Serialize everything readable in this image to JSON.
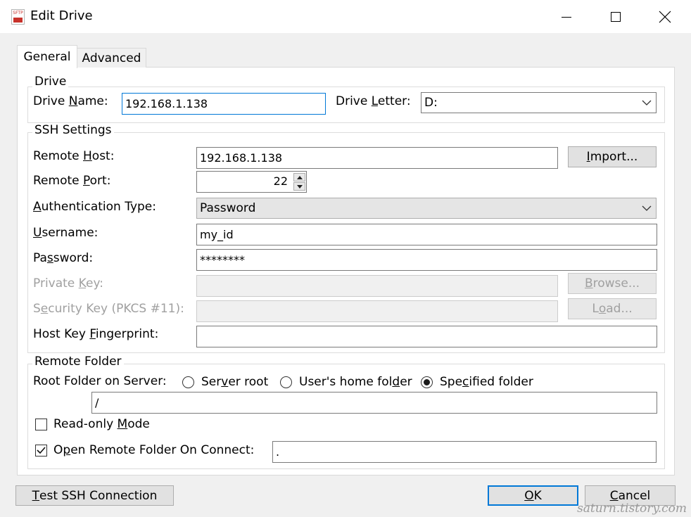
{
  "window": {
    "title": "Edit Drive",
    "app_icon_text": "SFTP"
  },
  "tabs": [
    {
      "label": "General",
      "selected": true
    },
    {
      "label": "Advanced",
      "selected": false
    }
  ],
  "drive": {
    "legend": "Drive",
    "name_label_pre": "Drive ",
    "name_label_u": "N",
    "name_label_post": "ame:",
    "name_value": "192.168.1.138",
    "letter_label_pre": "Drive ",
    "letter_label_u": "L",
    "letter_label_post": "etter:",
    "letter_value": "D:"
  },
  "ssh": {
    "legend": "SSH Settings",
    "host_label_pre": "Remote ",
    "host_label_u": "H",
    "host_label_post": "ost:",
    "host_value": "192.168.1.138",
    "import_pre": "",
    "import_u": "I",
    "import_post": "mport...",
    "port_label_pre": "Remote ",
    "port_label_u": "P",
    "port_label_post": "ort:",
    "port_value": "22",
    "auth_label_pre": "",
    "auth_label_u": "A",
    "auth_label_post": "uthentication Type:",
    "auth_value": "Password",
    "user_label_pre": "",
    "user_label_u": "U",
    "user_label_post": "sername:",
    "user_value": "my_id",
    "pass_label_pre": "Pa",
    "pass_label_u": "s",
    "pass_label_post": "sword:",
    "pass_value": "********",
    "pkey_label_pre": "Private ",
    "pkey_label_u": "K",
    "pkey_label_post": "ey:",
    "pkey_value": "",
    "browse_pre": "",
    "browse_u": "B",
    "browse_post": "rowse...",
    "seckey_label_pre": "S",
    "seckey_label_u": "e",
    "seckey_label_post": "curity Key (PKCS #11):",
    "seckey_value": "",
    "load_pre": "L",
    "load_u": "o",
    "load_post": "ad...",
    "fp_label_pre": "Host Key ",
    "fp_label_u": "F",
    "fp_label_post": "ingerprint:",
    "fp_value": ""
  },
  "remote": {
    "legend": "Remote Folder",
    "root_label": "Root Folder on Server:",
    "opt_server_pre": "Ser",
    "opt_server_u": "v",
    "opt_server_post": "er root",
    "opt_home_pre": "User's home fol",
    "opt_home_u": "d",
    "opt_home_post": "er",
    "opt_spec_pre": "Spe",
    "opt_spec_u": "c",
    "opt_spec_post": "ified folder",
    "selected_option": "Specified folder",
    "folder_value": "/",
    "readonly_pre": "Read-only ",
    "readonly_u": "M",
    "readonly_post": "ode",
    "readonly_checked": false,
    "open_pre": "O",
    "open_u": "p",
    "open_post": "en Remote Folder On Connect:",
    "open_checked": true,
    "open_value": "."
  },
  "footer": {
    "test_pre": "",
    "test_u": "T",
    "test_post": "est SSH Connection",
    "ok_pre": "",
    "ok_u": "O",
    "ok_post": "K",
    "cancel_pre": "",
    "cancel_u": "C",
    "cancel_post": "ancel"
  },
  "watermark": "saturn.tistory.com",
  "colors": {
    "focus_border": "#0078d7",
    "app_icon_red": "#c8322b",
    "disabled_text": "#a0a0a0"
  }
}
